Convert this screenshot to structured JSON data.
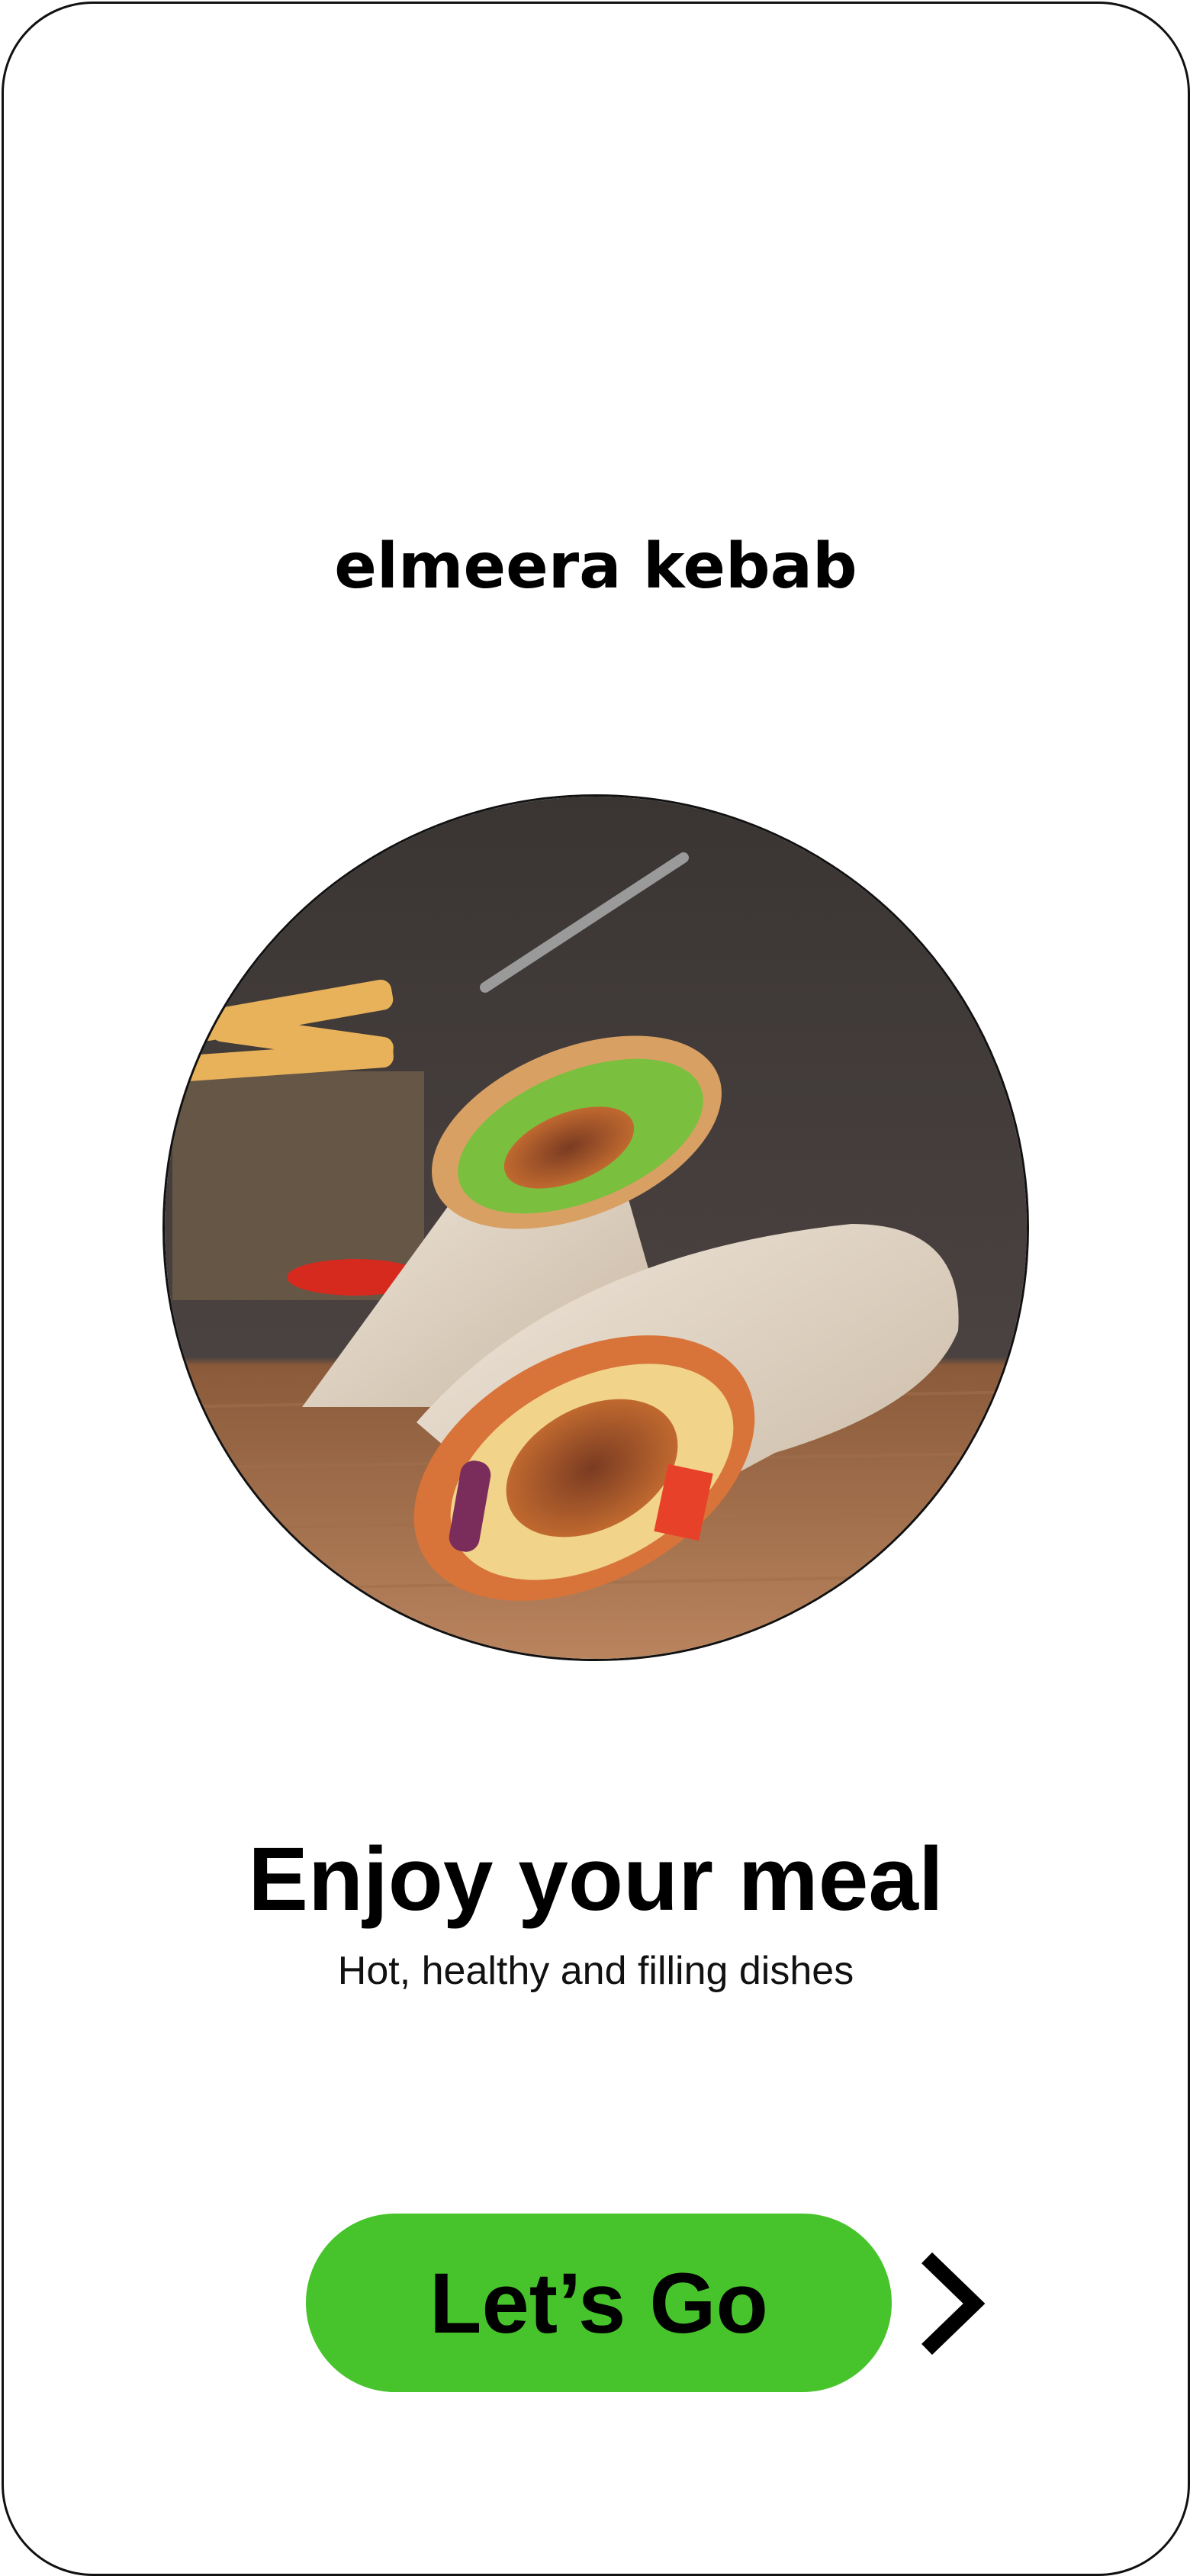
{
  "brand": {
    "name": "elmeera kebab"
  },
  "hero": {
    "image": "kebab-wrap-photo"
  },
  "headline": {
    "title": "Enjoy your meal",
    "subtitle": "Hot, healthy and filling dishes"
  },
  "cta": {
    "label": "Let’s Go",
    "color": "#47c42c"
  },
  "icons": {
    "next": "chevron-right-icon"
  }
}
